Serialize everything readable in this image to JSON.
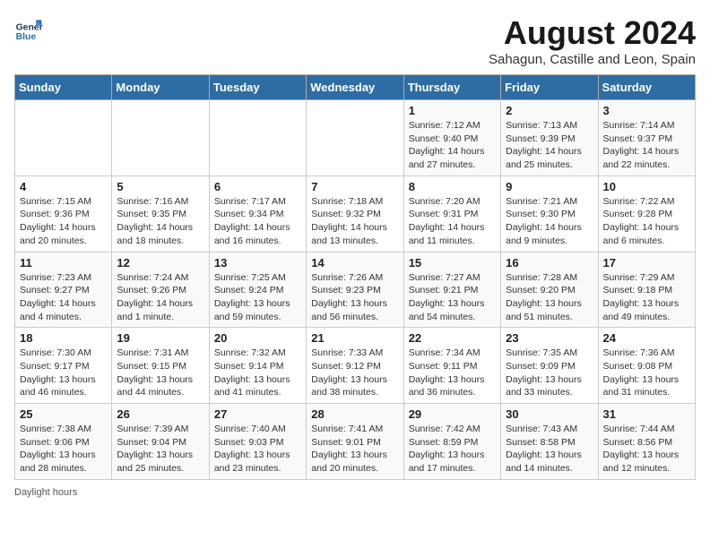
{
  "header": {
    "logo_line1": "General",
    "logo_line2": "Blue",
    "month_year": "August 2024",
    "location": "Sahagun, Castille and Leon, Spain"
  },
  "days_of_week": [
    "Sunday",
    "Monday",
    "Tuesday",
    "Wednesday",
    "Thursday",
    "Friday",
    "Saturday"
  ],
  "weeks": [
    [
      {
        "day": "",
        "info": ""
      },
      {
        "day": "",
        "info": ""
      },
      {
        "day": "",
        "info": ""
      },
      {
        "day": "",
        "info": ""
      },
      {
        "day": "1",
        "info": "Sunrise: 7:12 AM\nSunset: 9:40 PM\nDaylight: 14 hours and 27 minutes."
      },
      {
        "day": "2",
        "info": "Sunrise: 7:13 AM\nSunset: 9:39 PM\nDaylight: 14 hours and 25 minutes."
      },
      {
        "day": "3",
        "info": "Sunrise: 7:14 AM\nSunset: 9:37 PM\nDaylight: 14 hours and 22 minutes."
      }
    ],
    [
      {
        "day": "4",
        "info": "Sunrise: 7:15 AM\nSunset: 9:36 PM\nDaylight: 14 hours and 20 minutes."
      },
      {
        "day": "5",
        "info": "Sunrise: 7:16 AM\nSunset: 9:35 PM\nDaylight: 14 hours and 18 minutes."
      },
      {
        "day": "6",
        "info": "Sunrise: 7:17 AM\nSunset: 9:34 PM\nDaylight: 14 hours and 16 minutes."
      },
      {
        "day": "7",
        "info": "Sunrise: 7:18 AM\nSunset: 9:32 PM\nDaylight: 14 hours and 13 minutes."
      },
      {
        "day": "8",
        "info": "Sunrise: 7:20 AM\nSunset: 9:31 PM\nDaylight: 14 hours and 11 minutes."
      },
      {
        "day": "9",
        "info": "Sunrise: 7:21 AM\nSunset: 9:30 PM\nDaylight: 14 hours and 9 minutes."
      },
      {
        "day": "10",
        "info": "Sunrise: 7:22 AM\nSunset: 9:28 PM\nDaylight: 14 hours and 6 minutes."
      }
    ],
    [
      {
        "day": "11",
        "info": "Sunrise: 7:23 AM\nSunset: 9:27 PM\nDaylight: 14 hours and 4 minutes."
      },
      {
        "day": "12",
        "info": "Sunrise: 7:24 AM\nSunset: 9:26 PM\nDaylight: 14 hours and 1 minute."
      },
      {
        "day": "13",
        "info": "Sunrise: 7:25 AM\nSunset: 9:24 PM\nDaylight: 13 hours and 59 minutes."
      },
      {
        "day": "14",
        "info": "Sunrise: 7:26 AM\nSunset: 9:23 PM\nDaylight: 13 hours and 56 minutes."
      },
      {
        "day": "15",
        "info": "Sunrise: 7:27 AM\nSunset: 9:21 PM\nDaylight: 13 hours and 54 minutes."
      },
      {
        "day": "16",
        "info": "Sunrise: 7:28 AM\nSunset: 9:20 PM\nDaylight: 13 hours and 51 minutes."
      },
      {
        "day": "17",
        "info": "Sunrise: 7:29 AM\nSunset: 9:18 PM\nDaylight: 13 hours and 49 minutes."
      }
    ],
    [
      {
        "day": "18",
        "info": "Sunrise: 7:30 AM\nSunset: 9:17 PM\nDaylight: 13 hours and 46 minutes."
      },
      {
        "day": "19",
        "info": "Sunrise: 7:31 AM\nSunset: 9:15 PM\nDaylight: 13 hours and 44 minutes."
      },
      {
        "day": "20",
        "info": "Sunrise: 7:32 AM\nSunset: 9:14 PM\nDaylight: 13 hours and 41 minutes."
      },
      {
        "day": "21",
        "info": "Sunrise: 7:33 AM\nSunset: 9:12 PM\nDaylight: 13 hours and 38 minutes."
      },
      {
        "day": "22",
        "info": "Sunrise: 7:34 AM\nSunset: 9:11 PM\nDaylight: 13 hours and 36 minutes."
      },
      {
        "day": "23",
        "info": "Sunrise: 7:35 AM\nSunset: 9:09 PM\nDaylight: 13 hours and 33 minutes."
      },
      {
        "day": "24",
        "info": "Sunrise: 7:36 AM\nSunset: 9:08 PM\nDaylight: 13 hours and 31 minutes."
      }
    ],
    [
      {
        "day": "25",
        "info": "Sunrise: 7:38 AM\nSunset: 9:06 PM\nDaylight: 13 hours and 28 minutes."
      },
      {
        "day": "26",
        "info": "Sunrise: 7:39 AM\nSunset: 9:04 PM\nDaylight: 13 hours and 25 minutes."
      },
      {
        "day": "27",
        "info": "Sunrise: 7:40 AM\nSunset: 9:03 PM\nDaylight: 13 hours and 23 minutes."
      },
      {
        "day": "28",
        "info": "Sunrise: 7:41 AM\nSunset: 9:01 PM\nDaylight: 13 hours and 20 minutes."
      },
      {
        "day": "29",
        "info": "Sunrise: 7:42 AM\nSunset: 8:59 PM\nDaylight: 13 hours and 17 minutes."
      },
      {
        "day": "30",
        "info": "Sunrise: 7:43 AM\nSunset: 8:58 PM\nDaylight: 13 hours and 14 minutes."
      },
      {
        "day": "31",
        "info": "Sunrise: 7:44 AM\nSunset: 8:56 PM\nDaylight: 13 hours and 12 minutes."
      }
    ]
  ],
  "footer": {
    "daylight_label": "Daylight hours"
  }
}
